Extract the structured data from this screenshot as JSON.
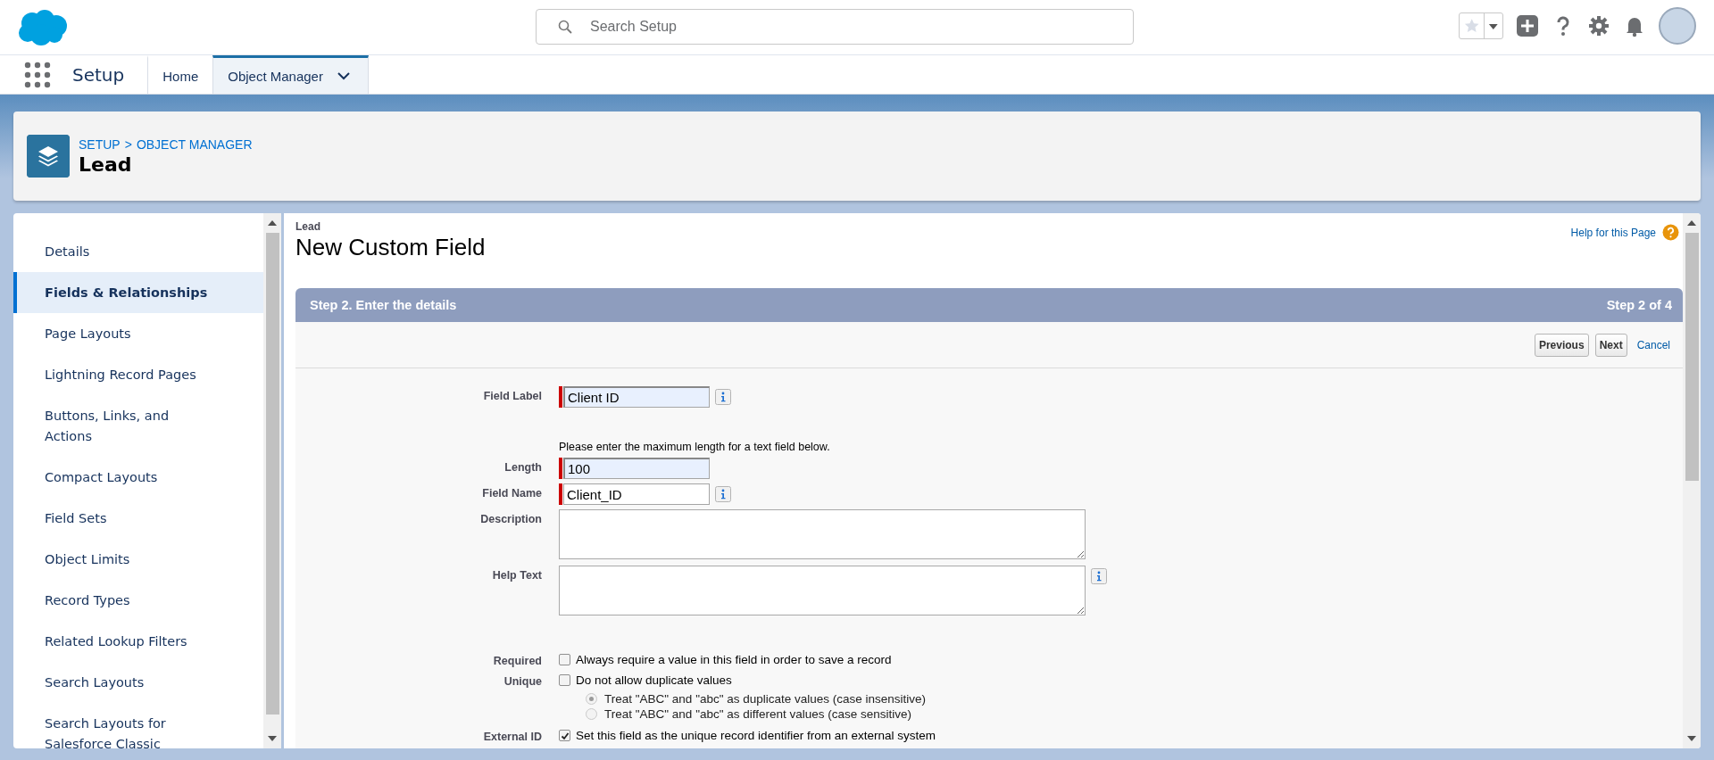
{
  "search": {
    "placeholder": "Search Setup"
  },
  "nav": {
    "app_title": "Setup",
    "tabs": [
      {
        "label": "Home",
        "selected": false,
        "menu": false
      },
      {
        "label": "Object Manager",
        "selected": true,
        "menu": true
      }
    ]
  },
  "header": {
    "breadcrumb": [
      "SETUP",
      "OBJECT MANAGER"
    ],
    "separator": ">",
    "title": "Lead"
  },
  "sidebar": {
    "items": [
      {
        "label": "Details",
        "selected": false
      },
      {
        "label": "Fields & Relationships",
        "selected": true
      },
      {
        "label": "Page Layouts",
        "selected": false
      },
      {
        "label": "Lightning Record Pages",
        "selected": false
      },
      {
        "label": "Buttons, Links, and Actions",
        "selected": false
      },
      {
        "label": "Compact Layouts",
        "selected": false
      },
      {
        "label": "Field Sets",
        "selected": false
      },
      {
        "label": "Object Limits",
        "selected": false
      },
      {
        "label": "Record Types",
        "selected": false
      },
      {
        "label": "Related Lookup Filters",
        "selected": false
      },
      {
        "label": "Search Layouts",
        "selected": false
      },
      {
        "label": "Search Layouts for Salesforce Classic",
        "selected": false
      }
    ]
  },
  "page": {
    "object": "Lead",
    "title": "New Custom Field",
    "help_link": "Help for this Page"
  },
  "step": {
    "title": "Step 2. Enter the details",
    "counter": "Step 2 of 4",
    "buttons": [
      "Previous",
      "Next"
    ],
    "cancel": "Cancel",
    "fields": [
      {
        "kind": "text",
        "label": "Field Label",
        "value": "Client ID",
        "required": true,
        "highlighted": true,
        "info": true
      },
      {
        "kind": "note",
        "text": "Please enter the maximum length for a text field below."
      },
      {
        "kind": "text",
        "label": "Length",
        "value": "100",
        "required": true,
        "highlighted": true,
        "info": false
      },
      {
        "kind": "text",
        "label": "Field Name",
        "value": "Client_ID",
        "required": true,
        "highlighted": false,
        "info": true
      },
      {
        "kind": "textarea",
        "label": "Description",
        "info": false
      },
      {
        "kind": "textarea",
        "label": "Help Text",
        "info": true
      },
      {
        "kind": "checkbox",
        "label": "Required",
        "text": "Always require a value in this field in order to save a record",
        "checked": false
      },
      {
        "kind": "checkbox",
        "label": "Unique",
        "text": "Do not allow duplicate values",
        "checked": false,
        "options": [
          {
            "text": "Treat \"ABC\" and \"abc\" as duplicate values (case insensitive)",
            "selected": true,
            "disabled": true
          },
          {
            "text": "Treat \"ABC\" and \"abc\" as different values (case sensitive)",
            "selected": false,
            "disabled": true
          }
        ]
      },
      {
        "kind": "checkbox",
        "label": "External ID",
        "text": "Set this field as the unique record identifier from an external system",
        "checked": true
      }
    ]
  }
}
